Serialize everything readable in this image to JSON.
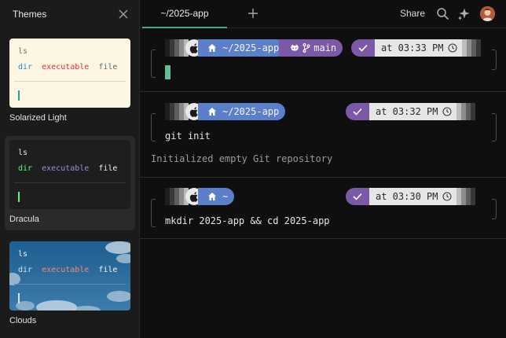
{
  "sidebar": {
    "title": "Themes",
    "themes": [
      {
        "name": "Solarized Light",
        "line1": "ls",
        "dir": "dir",
        "exe": "executable",
        "file": "file"
      },
      {
        "name": "Dracula",
        "line1": "ls",
        "dir": "dir",
        "exe": "executable",
        "file": "file"
      },
      {
        "name": "Clouds",
        "line1": "ls",
        "dir": "dir",
        "exe": "executable",
        "file": "file"
      }
    ],
    "selected_index": 1
  },
  "topbar": {
    "tab_label": "~/2025-app",
    "share_label": "Share"
  },
  "blocks": [
    {
      "path": "~/2025-app",
      "branch": "main",
      "time": "at 03:33 PM",
      "command": "",
      "output": ""
    },
    {
      "path": "~/2025-app",
      "time": "at 03:32 PM",
      "command": "git init",
      "output": "Initialized empty Git repository"
    },
    {
      "path": "~",
      "time": "at 03:30 PM",
      "command": "mkdir 2025-app && cd 2025-app",
      "output": ""
    }
  ],
  "colors": {
    "accent": "#46a78a",
    "path_segment": "#5b7fc9",
    "git_segment": "#7a5aa6",
    "cursor": "#5fbf92"
  },
  "icons": [
    "close-icon",
    "plus-icon",
    "search-icon",
    "sparkles-icon",
    "apple-icon",
    "home-icon",
    "github-icon",
    "branch-icon",
    "check-icon",
    "clock-icon"
  ]
}
